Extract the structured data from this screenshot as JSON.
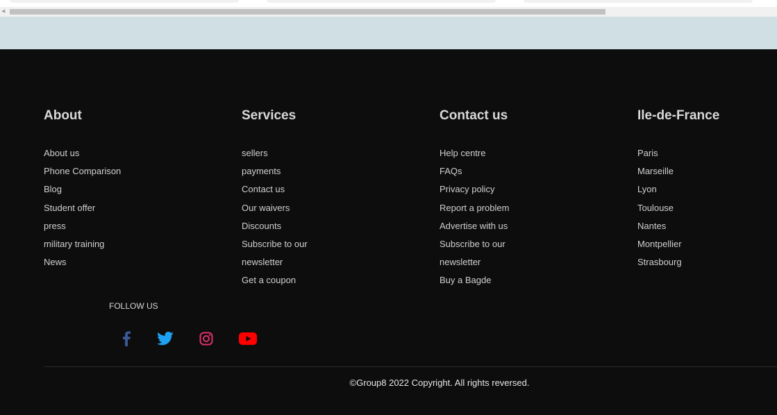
{
  "footer": {
    "columns": [
      {
        "title": "About",
        "links": [
          "About us",
          "Phone Comparison",
          "Blog",
          "Student offer",
          "press",
          "military training",
          "News"
        ]
      },
      {
        "title": "Services",
        "links": [
          "sellers",
          "payments",
          "Contact us",
          "Our waivers",
          "Discounts",
          "Subscribe to our",
          "newsletter",
          "Get a coupon"
        ]
      },
      {
        "title": "Contact us",
        "links": [
          "Help centre",
          "FAQs",
          "Privacy policy",
          "Report a problem",
          "Advertise with us",
          "Subscribe to our",
          "newsletter",
          "Buy a Bagde"
        ]
      },
      {
        "title": "Ile-de-France",
        "links": [
          "Paris",
          "Marseille",
          "Lyon",
          "Toulouse",
          "Nantes",
          "Montpellier",
          "Strasbourg"
        ]
      }
    ],
    "follow_label": "FOLLOW US",
    "social": [
      {
        "icon": "facebook-icon",
        "color": "#3b5998"
      },
      {
        "icon": "twitter-icon",
        "color": "#1da1f2"
      },
      {
        "icon": "instagram-icon",
        "color": "#e1306c"
      },
      {
        "icon": "youtube-icon",
        "color": "#ff0000"
      }
    ],
    "copyright": "©Group8 2022 Copyright. All rights reversed."
  },
  "colors": {
    "footer_bg": "#0d0d0d",
    "band_bg": "#cfdfe4",
    "heading": "#d9d9d9",
    "link": "#d0d0d0"
  }
}
